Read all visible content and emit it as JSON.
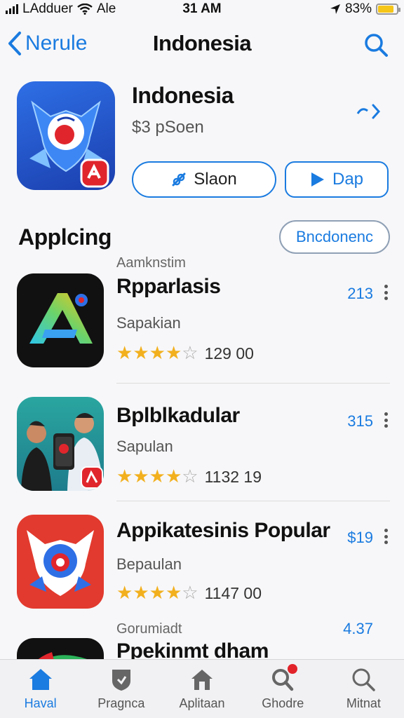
{
  "status_bar": {
    "carrier": "LAdduer",
    "network": "Ale",
    "time": "31 AM",
    "battery_percent": "83%",
    "battery_level": 0.83
  },
  "nav": {
    "back_label": "Nerule",
    "title": "Indonesia"
  },
  "featured": {
    "title": "Indonesia",
    "subtitle": "$3 pSoen",
    "secondary_button": "Slaon",
    "primary_button": "Dap"
  },
  "section": {
    "title": "Applcing",
    "pill": "Bncdonenc"
  },
  "apps": [
    {
      "category": "Aamknstim",
      "name": "Rpparlasis",
      "subtitle": "Sapakian",
      "rating": 4,
      "rating_count": "129 00",
      "price": "213"
    },
    {
      "category": "",
      "name": "Bplblkadular",
      "subtitle": "Sapulan",
      "rating": 4,
      "rating_count": "1132 19",
      "price": "315"
    },
    {
      "category": "",
      "name": "Appikatesinis Popular",
      "subtitle": "Bepaulan",
      "rating": 4,
      "rating_count": "1147 00",
      "price": "$19"
    },
    {
      "category": "Gorumiadt",
      "name": "Ppekinmt dham",
      "subtitle": "",
      "rating": 0,
      "rating_count": "",
      "price": "4.37"
    }
  ],
  "tabs": [
    {
      "label": "Haval",
      "icon": "home-icon",
      "active": true
    },
    {
      "label": "Pragnca",
      "icon": "shield-icon",
      "active": false
    },
    {
      "label": "Aplitaan",
      "icon": "house-outline-icon",
      "active": false
    },
    {
      "label": "Ghodre",
      "icon": "search-badge-icon",
      "active": false
    },
    {
      "label": "Mitnat",
      "icon": "search-icon",
      "active": false
    }
  ],
  "colors": {
    "accent": "#1a7be0",
    "star": "#f2b01e",
    "badge": "#e2232a"
  }
}
